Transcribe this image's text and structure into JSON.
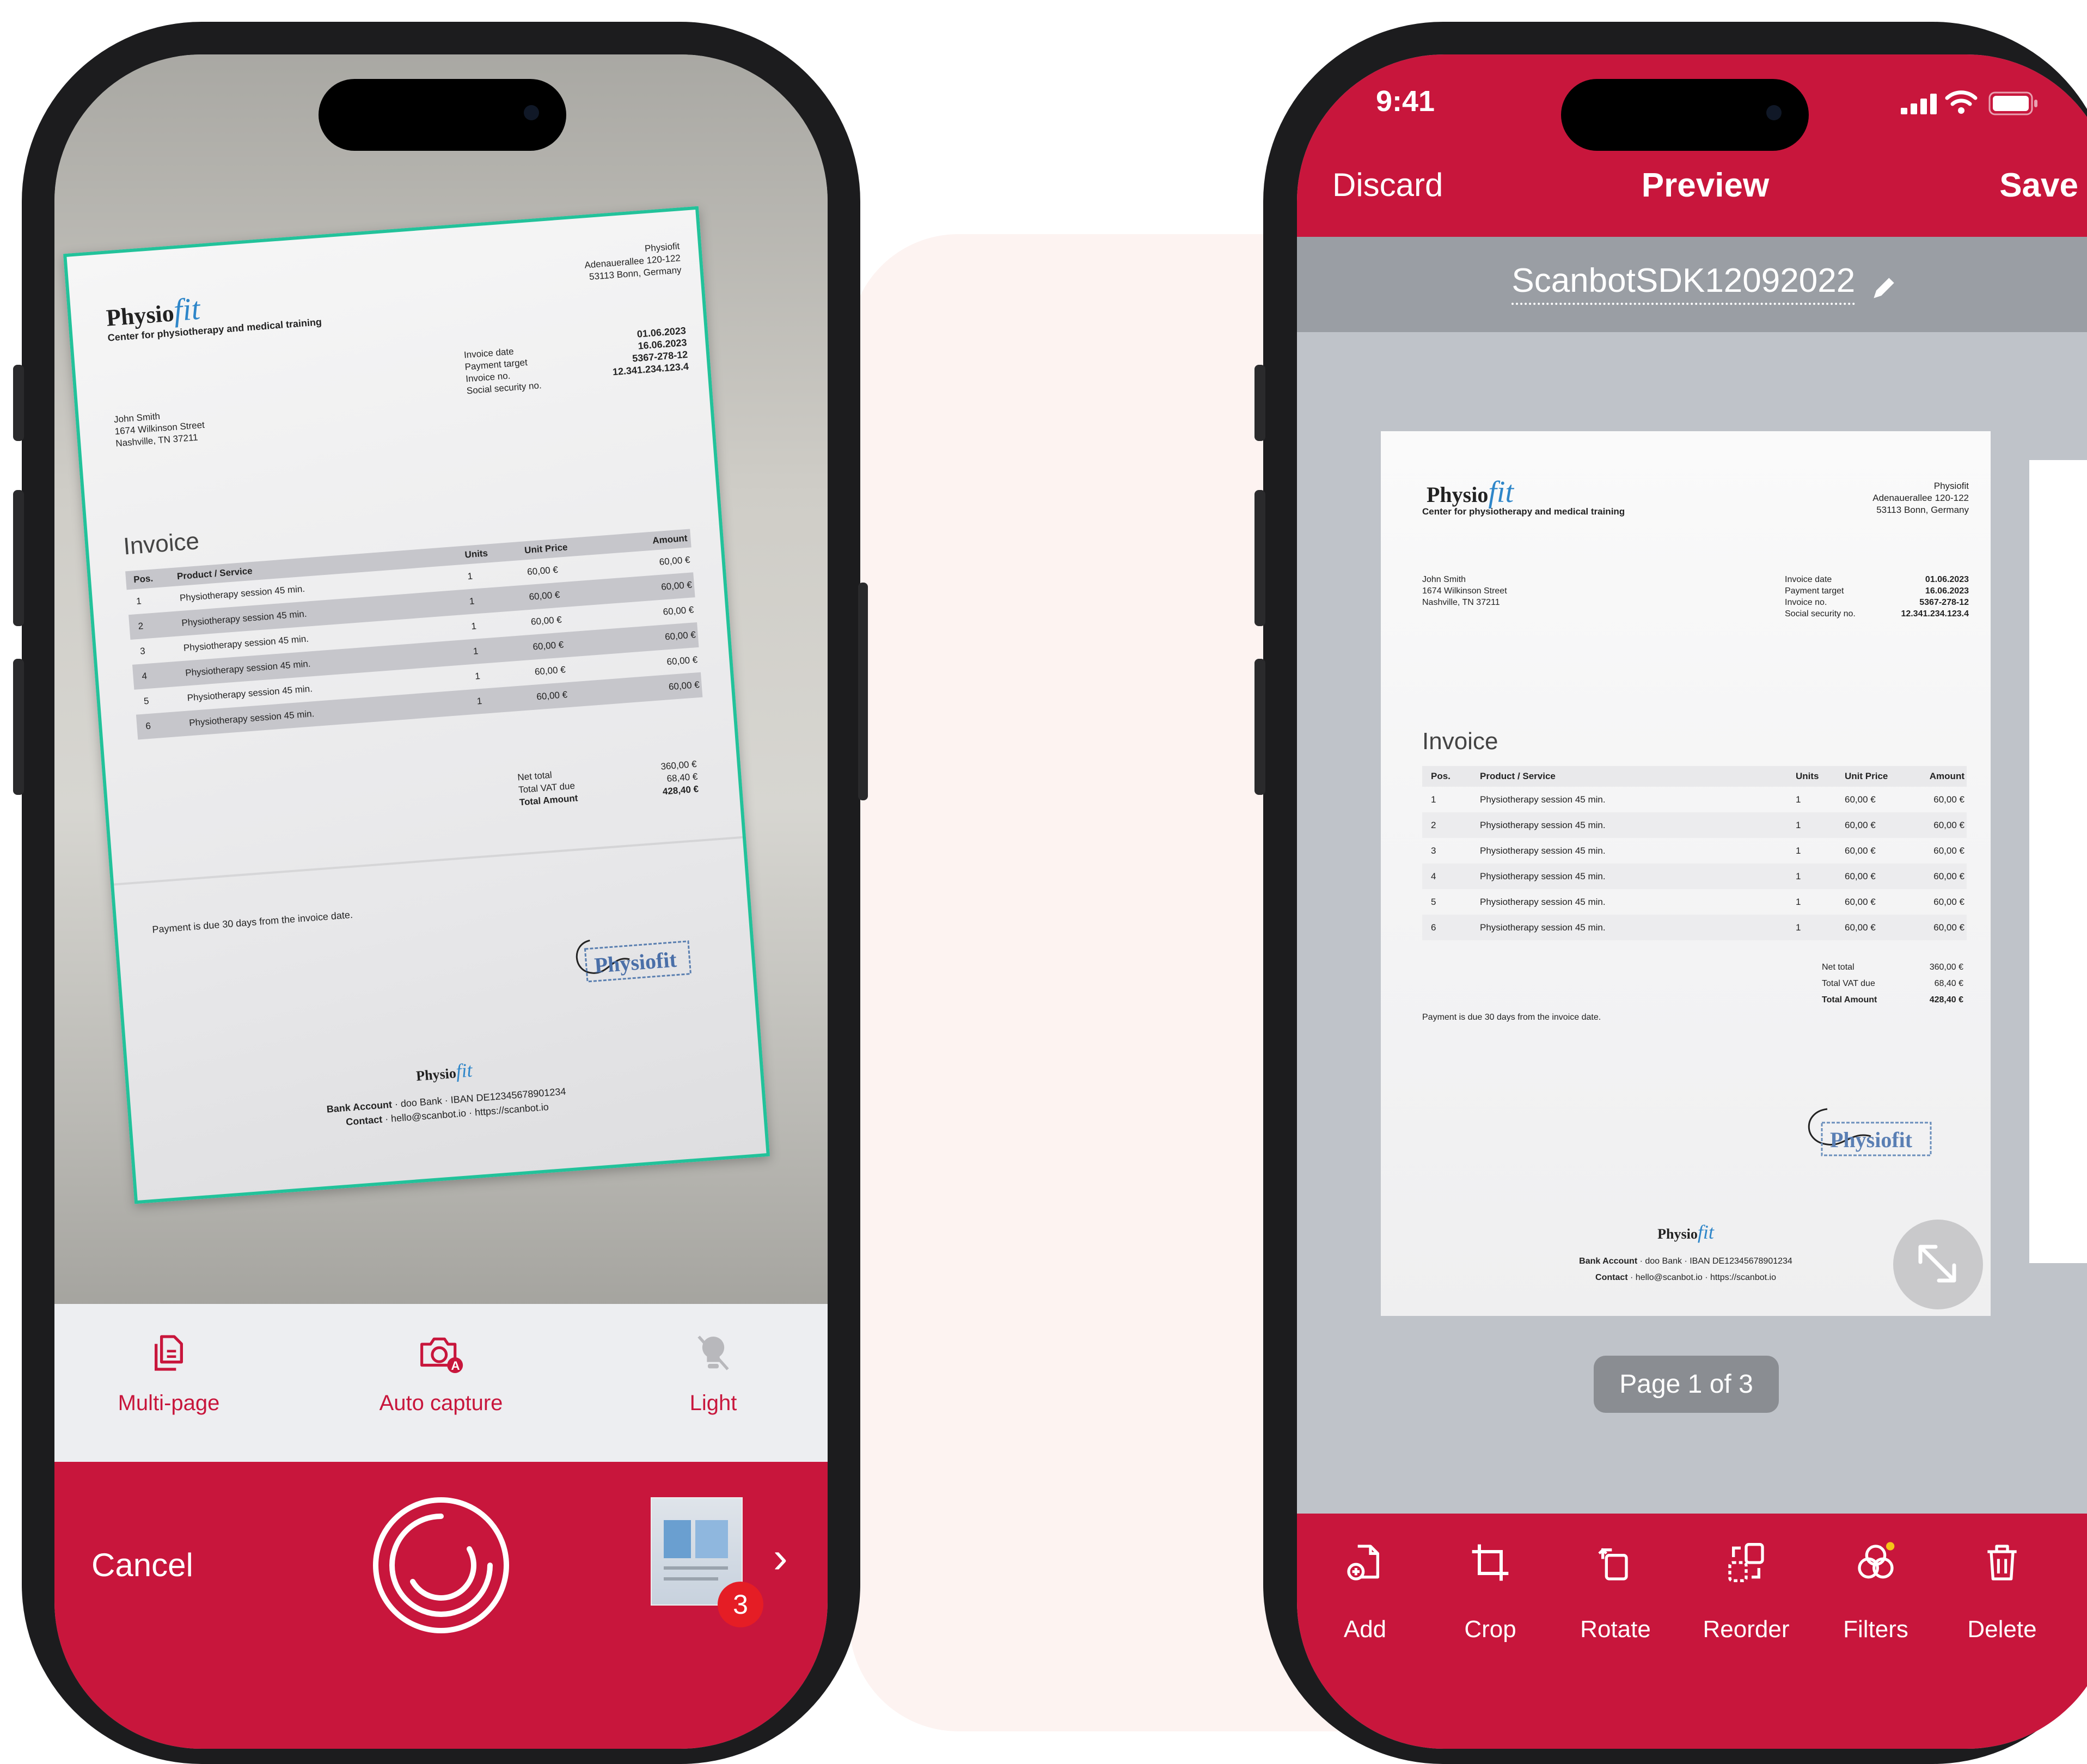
{
  "theme": {
    "accent": "#c8163c",
    "frame_green": "#22c29a",
    "brand_blue": "#2e86c9"
  },
  "invoice": {
    "brand_left": "Physio",
    "brand_right": "fit",
    "tagline": "Center for physiotherapy and medical training",
    "company_name": "Physiofit",
    "company_street": "Adenauerallee 120-122",
    "company_city": "53113 Bonn, Germany",
    "customer_name": "John Smith",
    "customer_street": "1674 Wilkinson Street",
    "customer_city": "Nashville, TN 37211",
    "meta_labels": [
      "Invoice date",
      "Payment target",
      "Invoice no.",
      "Social security no."
    ],
    "meta_values": [
      "01.06.2023",
      "16.06.2023",
      "5367-278-12",
      "12.341.234.123.4"
    ],
    "title": "Invoice",
    "headers": {
      "pos": "Pos.",
      "product": "Product / Service",
      "units": "Units",
      "unit_price": "Unit Price",
      "amount": "Amount"
    },
    "rows": [
      {
        "pos": "1",
        "product": "Physiotherapy session 45 min.",
        "units": "1",
        "unit_price": "60,00 €",
        "amount": "60,00 €"
      },
      {
        "pos": "2",
        "product": "Physiotherapy session 45 min.",
        "units": "1",
        "unit_price": "60,00 €",
        "amount": "60,00 €"
      },
      {
        "pos": "3",
        "product": "Physiotherapy session 45 min.",
        "units": "1",
        "unit_price": "60,00 €",
        "amount": "60,00 €"
      },
      {
        "pos": "4",
        "product": "Physiotherapy session 45 min.",
        "units": "1",
        "unit_price": "60,00 €",
        "amount": "60,00 €"
      },
      {
        "pos": "5",
        "product": "Physiotherapy session 45 min.",
        "units": "1",
        "unit_price": "60,00 €",
        "amount": "60,00 €"
      },
      {
        "pos": "6",
        "product": "Physiotherapy session 45 min.",
        "units": "1",
        "unit_price": "60,00 €",
        "amount": "60,00 €"
      }
    ],
    "totals": [
      {
        "label": "Net total",
        "value": "360,00 €"
      },
      {
        "label": "Total VAT due",
        "value": "68,40 €"
      },
      {
        "label": "Total Amount",
        "value": "428,40 €"
      }
    ],
    "payment_note": "Payment is due 30 days from the invoice date.",
    "stamp_text": "Physiofit",
    "bank_label": "Bank Account",
    "bank_value": "· doo Bank · IBAN DE12345678901234",
    "contact_label": "Contact",
    "contact_value": "· hello@scanbot.io · https://scanbot.io"
  },
  "scanner": {
    "options": [
      {
        "label": "Multi-page",
        "icon": "multi-page-icon"
      },
      {
        "label": "Auto capture",
        "icon": "camera-auto-icon"
      },
      {
        "label": "Light",
        "icon": "light-off-icon"
      }
    ],
    "cancel_label": "Cancel",
    "page_count": "3",
    "chevron": "›"
  },
  "preview": {
    "status_time": "9:41",
    "discard_label": "Discard",
    "title": "Preview",
    "save_label": "Save",
    "filename": "ScanbotSDK12092022",
    "page_indicator": "Page 1 of 3",
    "toolbar": [
      {
        "label": "Add",
        "icon": "add-page-icon"
      },
      {
        "label": "Crop",
        "icon": "crop-icon"
      },
      {
        "label": "Rotate",
        "icon": "rotate-icon"
      },
      {
        "label": "Reorder",
        "icon": "reorder-icon"
      },
      {
        "label": "Filters",
        "icon": "filters-icon"
      },
      {
        "label": "Delete",
        "icon": "trash-icon"
      }
    ]
  }
}
